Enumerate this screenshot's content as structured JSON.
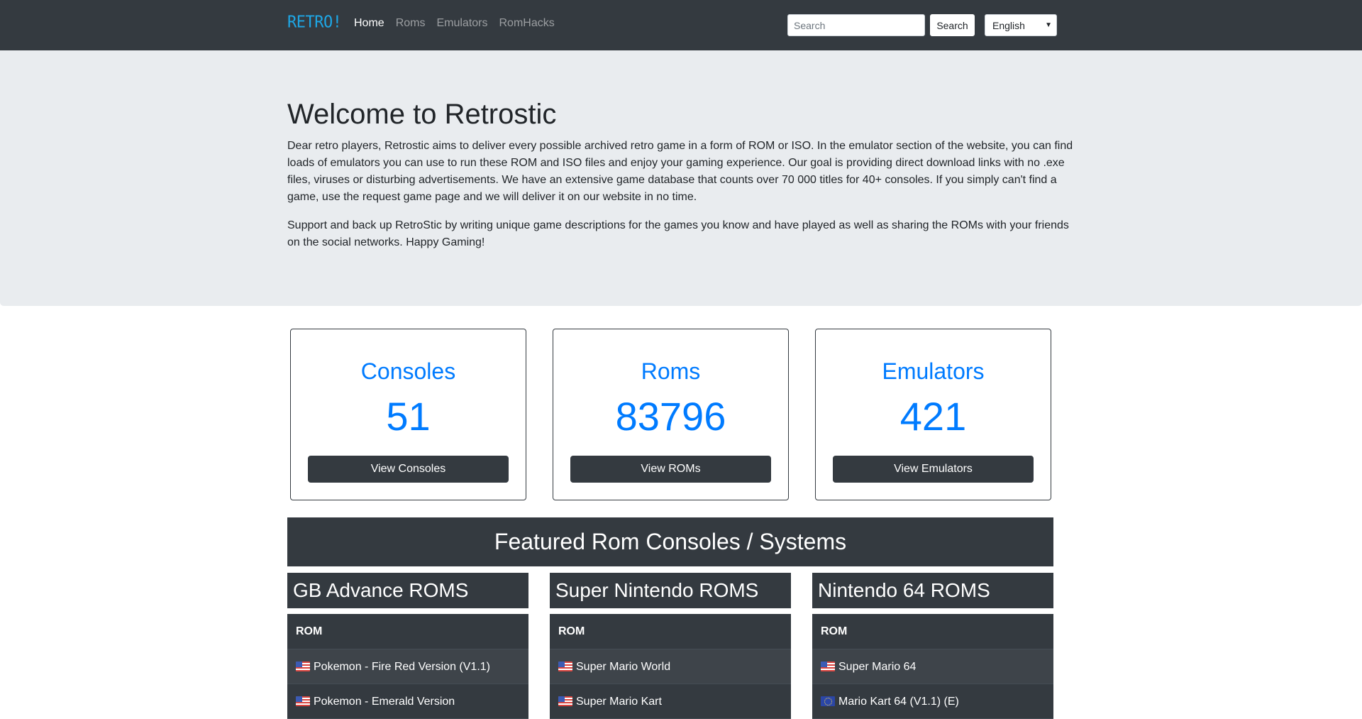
{
  "navbar": {
    "brand": "RETRO!",
    "links": [
      {
        "label": "Home",
        "active": true
      },
      {
        "label": "Roms",
        "active": false
      },
      {
        "label": "Emulators",
        "active": false
      },
      {
        "label": "RomHacks",
        "active": false
      }
    ],
    "search": {
      "placeholder": "Search",
      "value": "",
      "button_label": "Search"
    },
    "language": {
      "selected": "English"
    }
  },
  "jumbotron": {
    "title": "Welcome to Retrostic",
    "paragraph1": "Dear retro players, Retrostic aims to deliver every possible archived retro game in a form of ROM or ISO. In the emulator section of the website, you can find loads of emulators you can use to run these ROM and ISO files and enjoy your gaming experience. Our goal is providing direct download links with no .exe files, viruses or disturbing advertisements. We have an extensive game database that counts over 70 000 titles for 40+ consoles. If you simply can't find a game, use the request game page and we will deliver it on our website in no time.",
    "paragraph2": "Support and back up RetroStic by writing unique game descriptions for the games you know and have played as well as sharing the ROMs with your friends on the social networks. Happy Gaming!"
  },
  "stats": [
    {
      "title": "Consoles",
      "count": "51",
      "button": "View Consoles"
    },
    {
      "title": "Roms",
      "count": "83796",
      "button": "View ROMs"
    },
    {
      "title": "Emulators",
      "count": "421",
      "button": "View Emulators"
    }
  ],
  "featured": {
    "heading": "Featured Rom Consoles / Systems",
    "columns": [
      {
        "title": "GB Advance ROMS",
        "table_header": "ROM",
        "rows": [
          {
            "flag": "us-flag-icon",
            "name": "Pokemon - Fire Red Version (V1.1)"
          },
          {
            "flag": "us-flag-icon",
            "name": "Pokemon - Emerald Version"
          }
        ]
      },
      {
        "title": "Super Nintendo ROMS",
        "table_header": "ROM",
        "rows": [
          {
            "flag": "us-flag-icon",
            "name": "Super Mario World"
          },
          {
            "flag": "us-flag-icon",
            "name": "Super Mario Kart"
          }
        ]
      },
      {
        "title": "Nintendo 64 ROMS",
        "table_header": "ROM",
        "rows": [
          {
            "flag": "us-flag-icon",
            "name": "Super Mario 64"
          },
          {
            "flag": "eu-flag-icon",
            "name": "Mario Kart 64 (V1.1) (E)"
          }
        ]
      }
    ]
  },
  "colors": {
    "navbar_bg": "#343a40",
    "brand": "#1ea7e6",
    "jumbotron_bg": "#e9ecef",
    "accent_blue": "#007bff",
    "dark_button": "#343a40"
  }
}
